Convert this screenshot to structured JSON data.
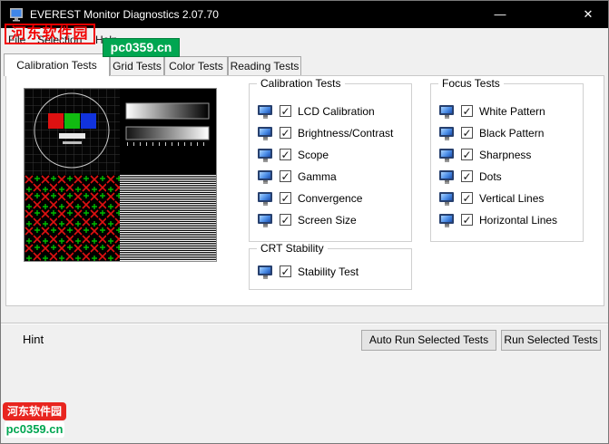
{
  "window": {
    "title": "EVEREST Monitor Diagnostics 2.07.70"
  },
  "icons": {
    "minimize": "—",
    "close": "✕",
    "check": "✓"
  },
  "menu": {
    "items": [
      "File",
      "Selection",
      "Help"
    ]
  },
  "watermarks": {
    "top_red": "河东软件园",
    "top_green": "pc0359.cn",
    "bottom_red": "河东软件园",
    "bottom_green": "pc0359.cn"
  },
  "tabs": [
    {
      "label": "Calibration Tests",
      "active": true
    },
    {
      "label": "Grid Tests",
      "active": false
    },
    {
      "label": "Color Tests",
      "active": false
    },
    {
      "label": "Reading Tests",
      "active": false
    }
  ],
  "groups": {
    "calibration": {
      "title": "Calibration Tests",
      "items": [
        {
          "label": "LCD Calibration",
          "checked": true
        },
        {
          "label": "Brightness/Contrast",
          "checked": true
        },
        {
          "label": "Scope",
          "checked": true
        },
        {
          "label": "Gamma",
          "checked": true
        },
        {
          "label": "Convergence",
          "checked": true
        },
        {
          "label": "Screen Size",
          "checked": true
        }
      ]
    },
    "focus": {
      "title": "Focus Tests",
      "items": [
        {
          "label": "White Pattern",
          "checked": true
        },
        {
          "label": "Black Pattern",
          "checked": true
        },
        {
          "label": "Sharpness",
          "checked": true
        },
        {
          "label": "Dots",
          "checked": true
        },
        {
          "label": "Vertical Lines",
          "checked": true
        },
        {
          "label": "Horizontal Lines",
          "checked": true
        }
      ]
    },
    "crt": {
      "title": "CRT Stability",
      "items": [
        {
          "label": "Stability Test",
          "checked": true
        }
      ]
    }
  },
  "buttons": {
    "auto_run": "Auto Run Selected Tests",
    "run": "Run Selected Tests"
  },
  "hint": {
    "label": "Hint"
  },
  "colors": {
    "titlebar": "#000000",
    "watermark_red": "#f20000",
    "watermark_green": "#00a651",
    "monitor_icon_blue": "#4d8fe8"
  }
}
